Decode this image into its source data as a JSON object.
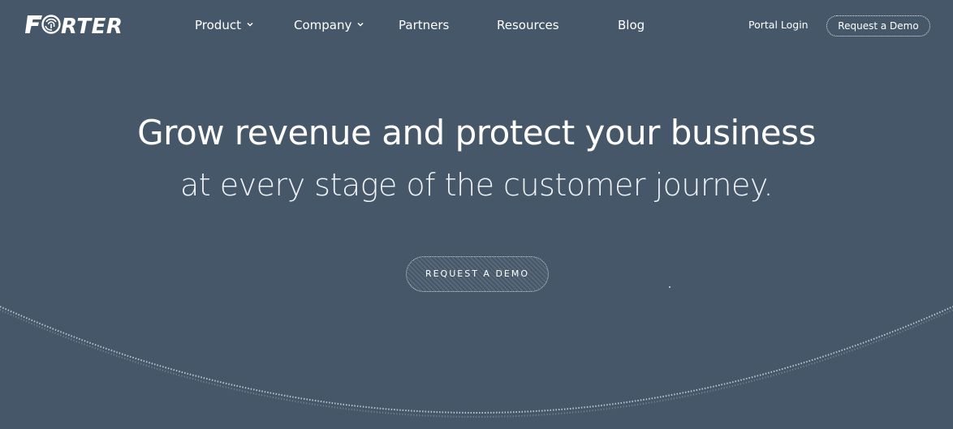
{
  "brand": {
    "logo_text": "FORTER",
    "colors": {
      "background": "#465769",
      "text": "#ffffff"
    }
  },
  "nav": {
    "items": [
      {
        "label": "Product",
        "has_dropdown": true
      },
      {
        "label": "Company",
        "has_dropdown": true
      },
      {
        "label": "Partners",
        "has_dropdown": false
      },
      {
        "label": "Resources",
        "has_dropdown": false
      },
      {
        "label": "Blog",
        "has_dropdown": false
      }
    ],
    "portal_login": "Portal Login",
    "request_demo": "Request a Demo"
  },
  "hero": {
    "title": "Grow revenue and protect your business",
    "subtitle": "at every stage of the customer journey.",
    "cta_label": "REQUEST A DEMO"
  }
}
